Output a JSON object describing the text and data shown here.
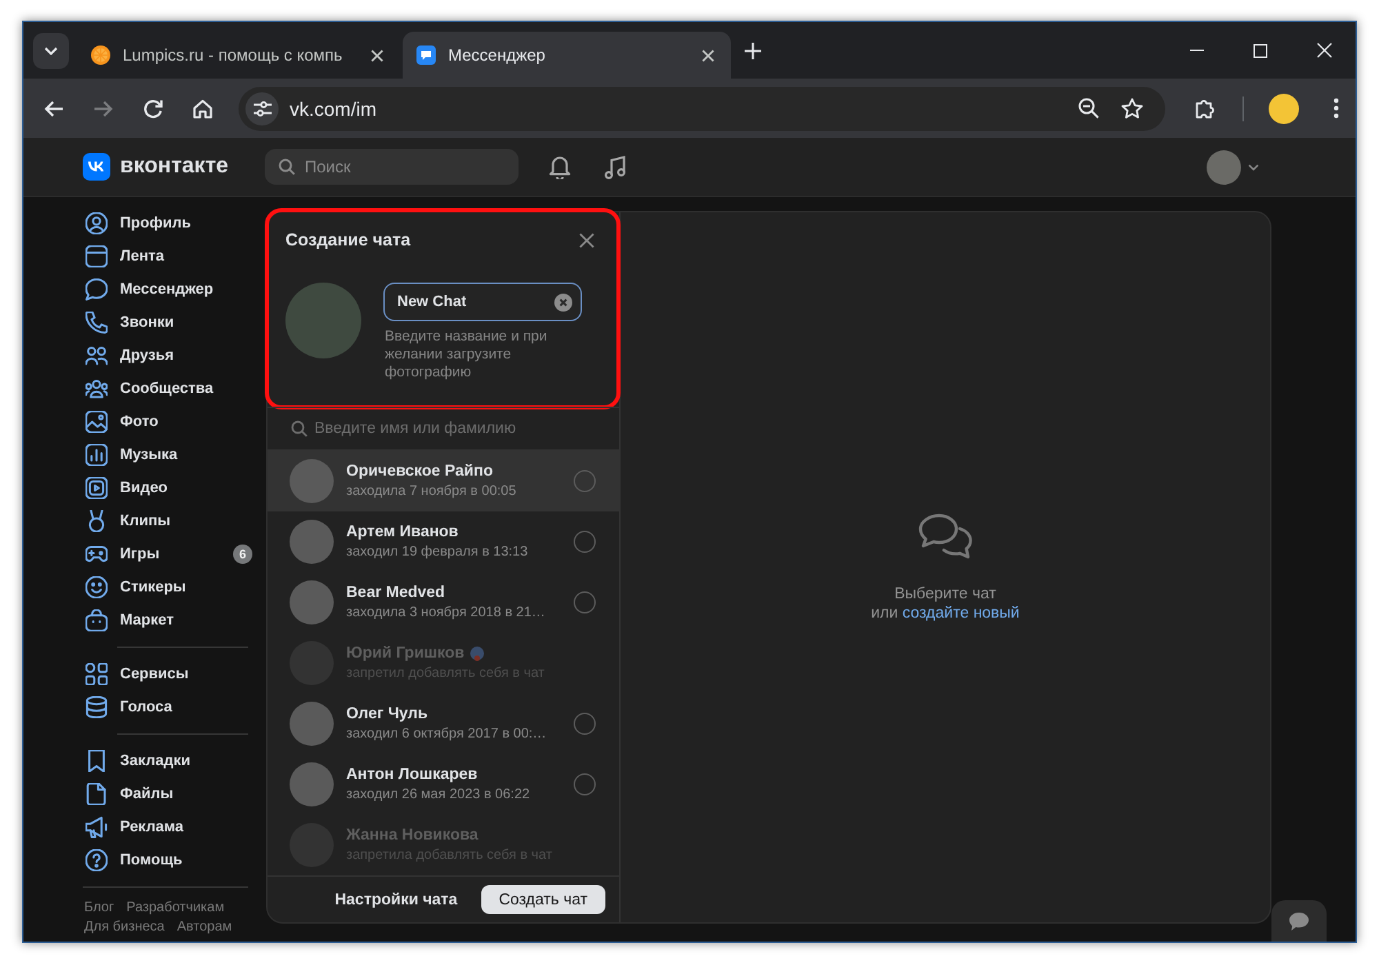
{
  "browser": {
    "tabs": [
      {
        "title": "Lumpics.ru - помощь с компь",
        "selected": false
      },
      {
        "title": "Мессенджер",
        "selected": true
      }
    ],
    "forward_disabled": true,
    "address": "vk.com/im"
  },
  "header": {
    "logo_text": "вконтакте",
    "search": {
      "placeholder": "Поиск"
    }
  },
  "sidebar": {
    "groups": [
      {
        "items": [
          {
            "label": "Профиль"
          },
          {
            "label": "Лента"
          },
          {
            "label": "Мессенджер"
          },
          {
            "label": "Звонки"
          },
          {
            "label": "Друзья"
          },
          {
            "label": "Сообщества"
          },
          {
            "label": "Фото"
          },
          {
            "label": "Музыка"
          },
          {
            "label": "Видео"
          },
          {
            "label": "Клипы"
          },
          {
            "label": "Игры",
            "badge": "6"
          },
          {
            "label": "Стикеры"
          },
          {
            "label": "Маркет"
          }
        ]
      },
      {
        "items": [
          {
            "label": "Сервисы"
          },
          {
            "label": "Голоса"
          }
        ]
      },
      {
        "items": [
          {
            "label": "Закладки"
          },
          {
            "label": "Файлы"
          },
          {
            "label": "Реклама"
          },
          {
            "label": "Помощь"
          }
        ]
      }
    ],
    "footer_links": [
      {
        "links": [
          "Блог",
          "Разработчикам"
        ]
      },
      {
        "links": [
          "Для бизнеса",
          "Авторам"
        ]
      }
    ]
  },
  "chat_create": {
    "title": "Создание чата",
    "name_field": {
      "value": "New Chat"
    },
    "hint": "Введите название и при желании загрузите фотографию",
    "member_search": {
      "placeholder": "Введите имя или фамилию"
    },
    "contacts": [
      {
        "name": "Оричевское Райпо",
        "status": "заходила 7 ноября в 00:05",
        "selected": false,
        "disabled": false,
        "hovered": true,
        "status_icon": false
      },
      {
        "name": "Артем Иванов",
        "status": "заходил 19 февраля в 13:13",
        "selected": false,
        "disabled": false,
        "hovered": false,
        "status_icon": false
      },
      {
        "name": "Bear Medved",
        "status": "заходила 3 ноября 2018 в 21…",
        "selected": false,
        "disabled": false,
        "hovered": false,
        "status_icon": false
      },
      {
        "name": "Юрий Гришков",
        "status": "запретил добавлять себя в чат",
        "selected": false,
        "disabled": true,
        "hovered": false,
        "status_icon": true
      },
      {
        "name": "Олег Чуль",
        "status": "заходил 6 октября 2017 в 00:…",
        "selected": false,
        "disabled": false,
        "hovered": false,
        "status_icon": false
      },
      {
        "name": "Антон Лошкарев",
        "status": "заходил 26 мая 2023 в 06:22",
        "selected": false,
        "disabled": false,
        "hovered": false,
        "status_icon": false
      },
      {
        "name": "Жанна Новикова",
        "status": "запретила добавлять себя в чат",
        "selected": false,
        "disabled": true,
        "hovered": false,
        "status_icon": false
      }
    ],
    "buttons": {
      "settings": "Настройки чата",
      "create": "Создать чат"
    }
  },
  "empty_state": {
    "line_1": "Выберите чат",
    "line_2": "или",
    "link": "создайте новый"
  }
}
